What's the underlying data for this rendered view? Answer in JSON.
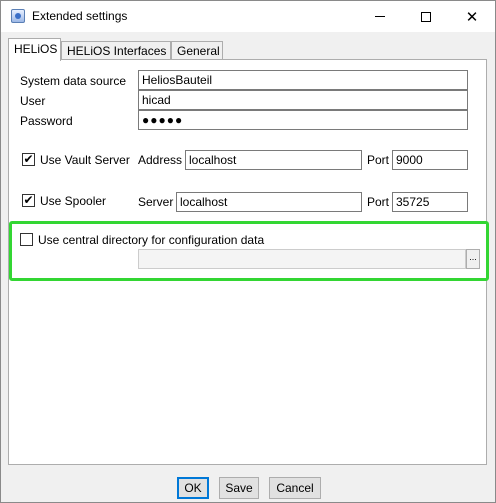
{
  "window": {
    "title": "Extended settings",
    "controls": {
      "minimize": "minimize",
      "maximize": "maximize",
      "close": "✕"
    }
  },
  "tabs": [
    {
      "label": "HELiOS",
      "active": true
    },
    {
      "label": "HELiOS Interfaces",
      "active": false
    },
    {
      "label": "General",
      "active": false
    }
  ],
  "form": {
    "system_data_source": {
      "label": "System data source",
      "value": "HeliosBauteil"
    },
    "user": {
      "label": "User",
      "value": "hicad"
    },
    "password": {
      "label": "Password",
      "value": "●●●●●"
    },
    "vault": {
      "checkbox_label": "Use Vault Server",
      "checked": true,
      "check_glyph": "✔",
      "address_label": "Address",
      "address_value": "localhost",
      "port_label": "Port",
      "port_value": "9000"
    },
    "spooler": {
      "checkbox_label": "Use Spooler",
      "checked": true,
      "check_glyph": "✔",
      "server_label": "Server",
      "server_value": "localhost",
      "port_label": "Port",
      "port_value": "35725"
    },
    "central_directory": {
      "checkbox_label": "Use central directory for configuration data",
      "checked": false,
      "path_value": "",
      "browse_label": "..."
    }
  },
  "buttons": {
    "ok": "OK",
    "save": "Save",
    "cancel": "Cancel"
  },
  "colors": {
    "highlight": "#33d633",
    "default_button_border": "#0078d7"
  }
}
